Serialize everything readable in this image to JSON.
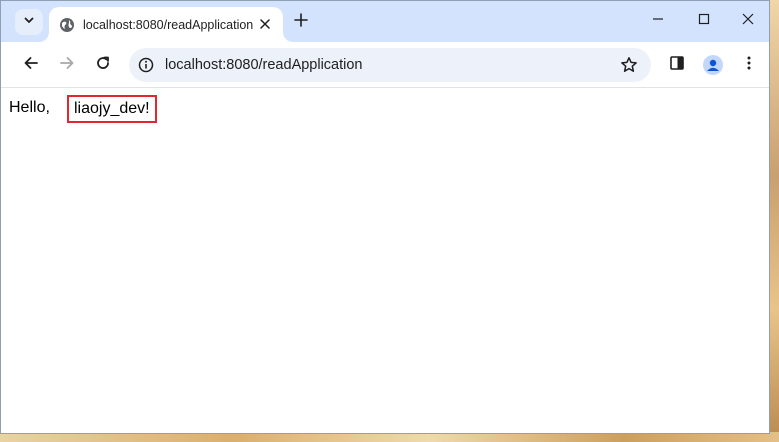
{
  "tab": {
    "title": "localhost:8080/readApplication",
    "favicon": "globe-icon"
  },
  "toolbar": {
    "url": "localhost:8080/readApplication"
  },
  "page": {
    "greeting_prefix": "Hello,",
    "greeting_name": "liaojy_dev!"
  },
  "colors": {
    "tabstrip_bg": "#d3e3fd",
    "omnibox_bg": "#edf2fa",
    "highlight_border": "#e0282e"
  }
}
